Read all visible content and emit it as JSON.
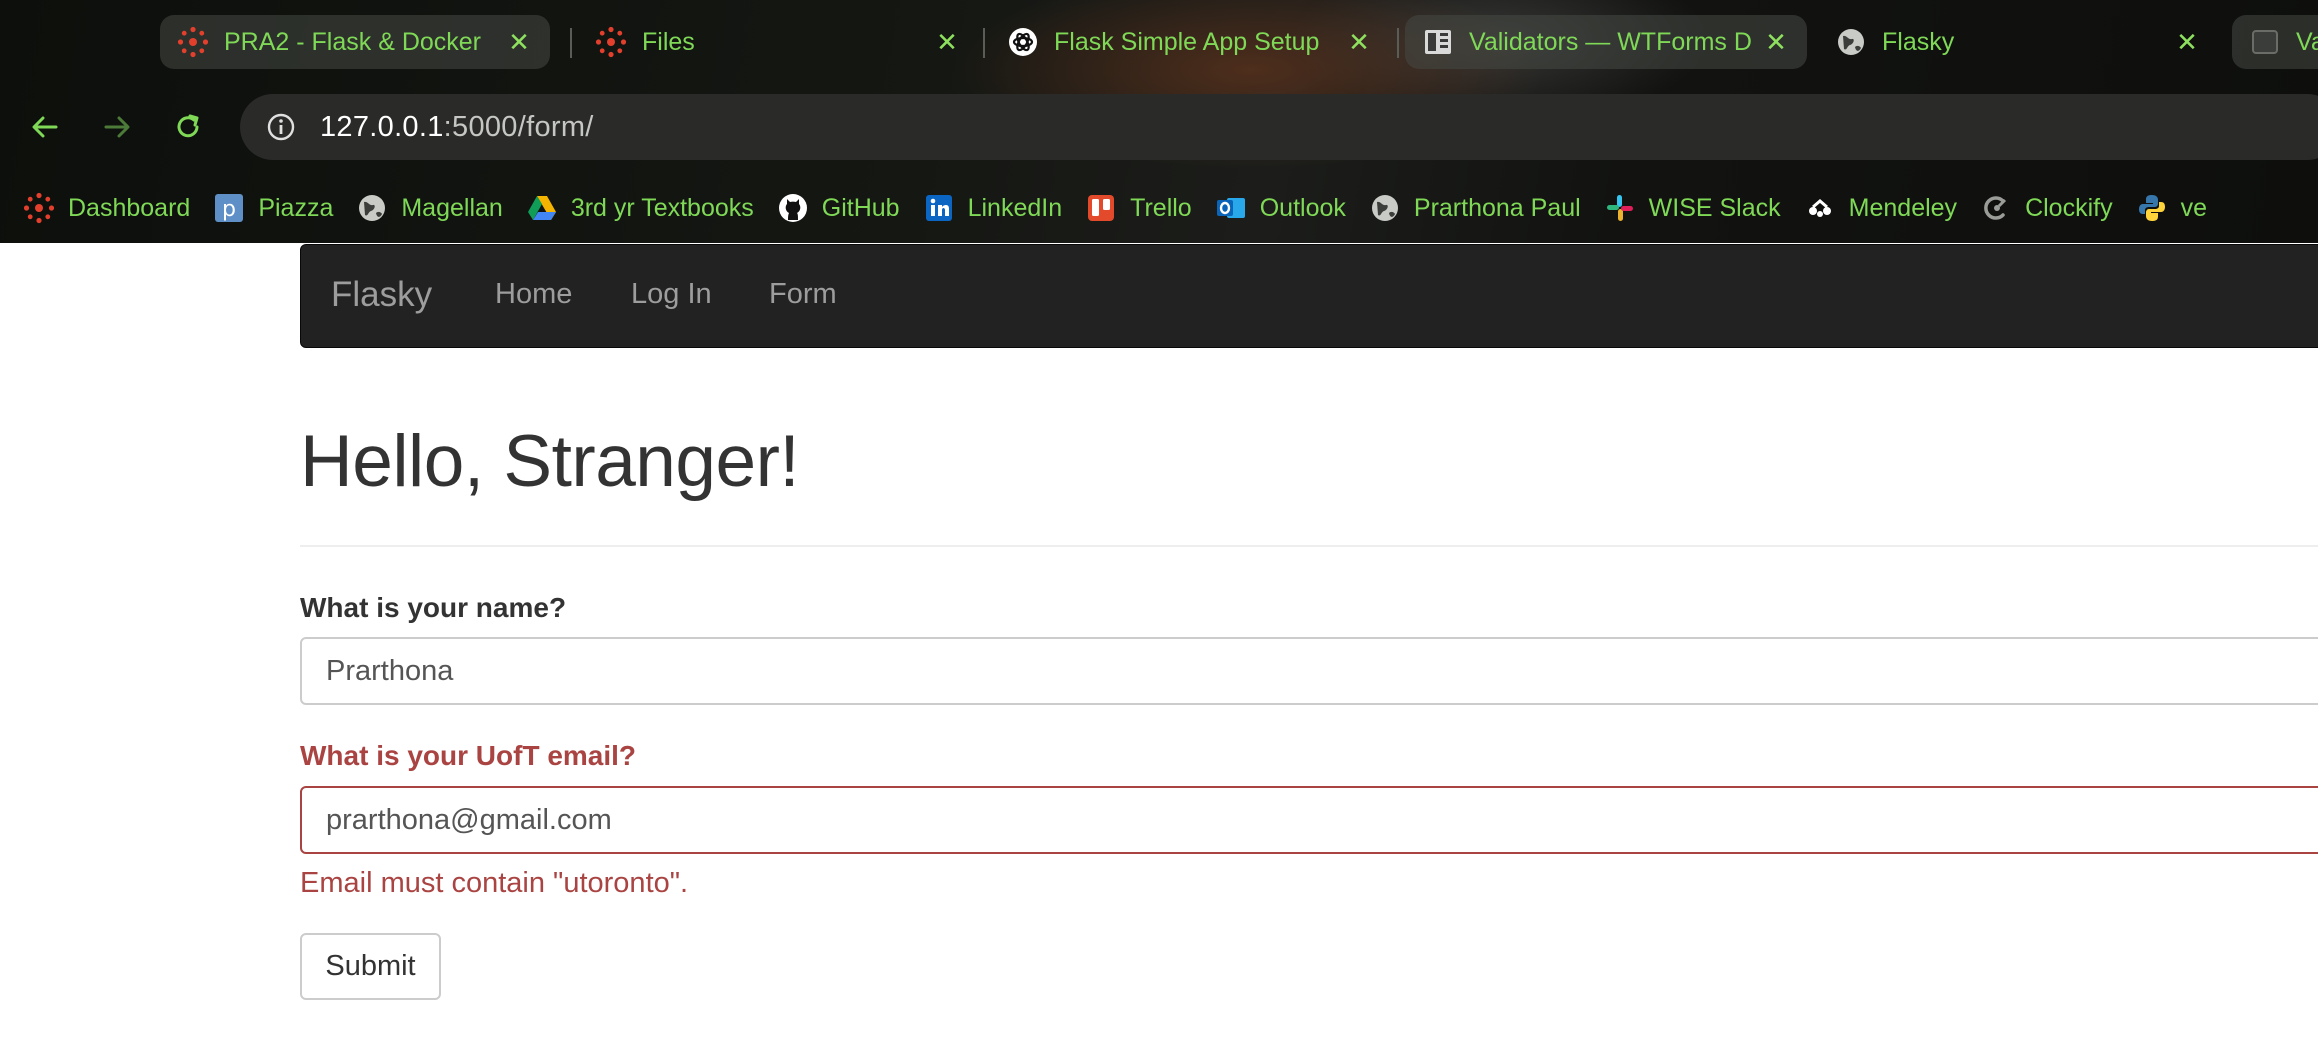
{
  "browser": {
    "tabs": [
      {
        "title": "PRA2 - Flask & Docker",
        "icon": "canvas-icon"
      },
      {
        "title": "Files",
        "icon": "canvas-icon"
      },
      {
        "title": "Flask Simple App Setup",
        "icon": "openai-icon"
      },
      {
        "title": "Validators — WTForms D",
        "icon": "docs-icon"
      },
      {
        "title": "Flasky",
        "icon": "globe-icon"
      },
      {
        "title": "Va",
        "icon": "page-icon"
      }
    ],
    "close_glyph": "✕",
    "url": {
      "host": "127.0.0.1",
      "rest": ":5000/form/"
    },
    "bookmarks": [
      {
        "label": "Dashboard",
        "icon": "canvas-icon"
      },
      {
        "label": "Piazza",
        "icon": "piazza-icon"
      },
      {
        "label": "Magellan",
        "icon": "globe-icon"
      },
      {
        "label": "3rd yr Textbooks",
        "icon": "google-drive-icon"
      },
      {
        "label": "GitHub",
        "icon": "github-icon"
      },
      {
        "label": "LinkedIn",
        "icon": "linkedin-icon"
      },
      {
        "label": "Trello",
        "icon": "trello-icon"
      },
      {
        "label": "Outlook",
        "icon": "outlook-icon"
      },
      {
        "label": "Prarthona Paul",
        "icon": "globe-icon"
      },
      {
        "label": "WISE Slack",
        "icon": "slack-icon"
      },
      {
        "label": "Mendeley",
        "icon": "mendeley-icon"
      },
      {
        "label": "Clockify",
        "icon": "clockify-icon"
      },
      {
        "label": "ve",
        "icon": "python-icon"
      }
    ],
    "colors": {
      "accent_text": "#7fd957"
    }
  },
  "navbar": {
    "brand": "Flasky",
    "links": [
      "Home",
      "Log In",
      "Form"
    ]
  },
  "page": {
    "header": "Hello, Stranger!"
  },
  "form": {
    "name_label": "What is your name?",
    "name_value": "Prarthona",
    "email_label": "What is your UofT email?",
    "email_value": "prarthona@gmail.com",
    "email_error": "Email must contain \"utoronto\".",
    "submit_label": "Submit",
    "colors": {
      "error": "#a94442"
    }
  }
}
